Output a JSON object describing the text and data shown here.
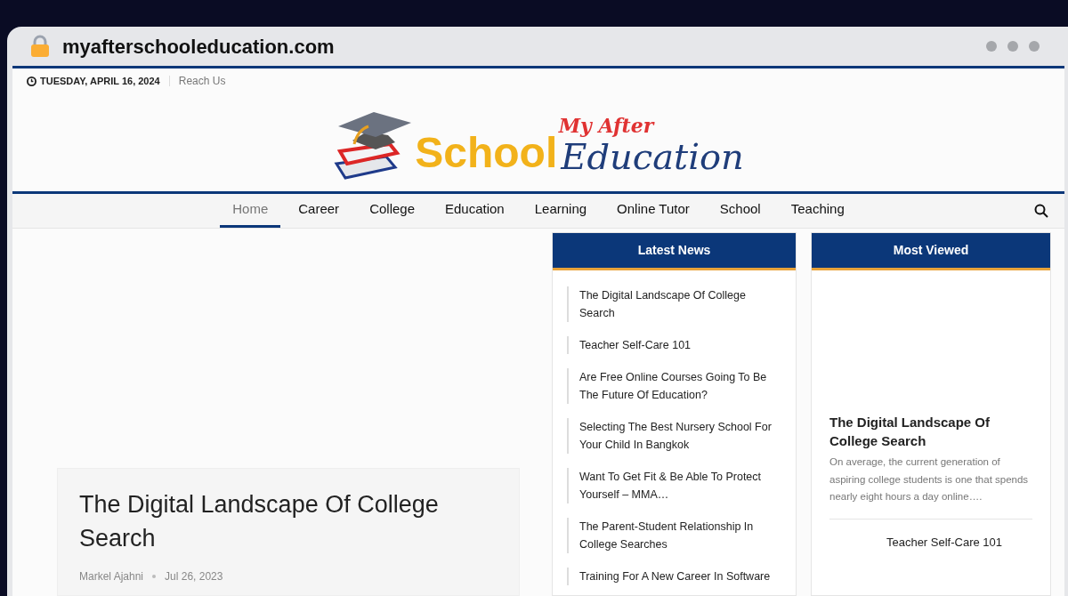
{
  "browser": {
    "url": "myafterschooleducation.com"
  },
  "top_bar": {
    "date": "TUESDAY, APRIL 16, 2024",
    "links": [
      "Reach Us"
    ]
  },
  "logo": {
    "line_1": "My After",
    "line_2a": "School",
    "line_2b": "Education"
  },
  "nav": [
    {
      "label": "Home",
      "selected": true
    },
    {
      "label": "Career",
      "selected": false
    },
    {
      "label": "College",
      "selected": false
    },
    {
      "label": "Education",
      "selected": false
    },
    {
      "label": "Learning",
      "selected": false
    },
    {
      "label": "Online Tutor",
      "selected": false
    },
    {
      "label": "School",
      "selected": false
    },
    {
      "label": "Teaching",
      "selected": false
    }
  ],
  "featured": {
    "title": "The Digital Landscape Of College Search",
    "author": "Markel Ajahni",
    "date": "Jul 26, 2023"
  },
  "latest_news": {
    "heading": "Latest News",
    "items": [
      "The Digital Landscape Of College Search",
      "Teacher Self-Care 101",
      "Are Free Online Courses Going To Be The Future Of Education?",
      "Selecting The Best Nursery School For Your Child In Bangkok",
      "Want To Get Fit & Be Able To Protect Yourself – MMA…",
      "The Parent-Student Relationship In College Searches",
      "Training For A New Career In Software"
    ]
  },
  "most_viewed": {
    "heading": "Most Viewed",
    "top": {
      "title": "The Digital Landscape Of College Search",
      "excerpt": "On average, the current generation of aspiring college students is one that spends nearly eight hours a day online…."
    },
    "items": [
      "Teacher Self-Care 101"
    ]
  }
}
